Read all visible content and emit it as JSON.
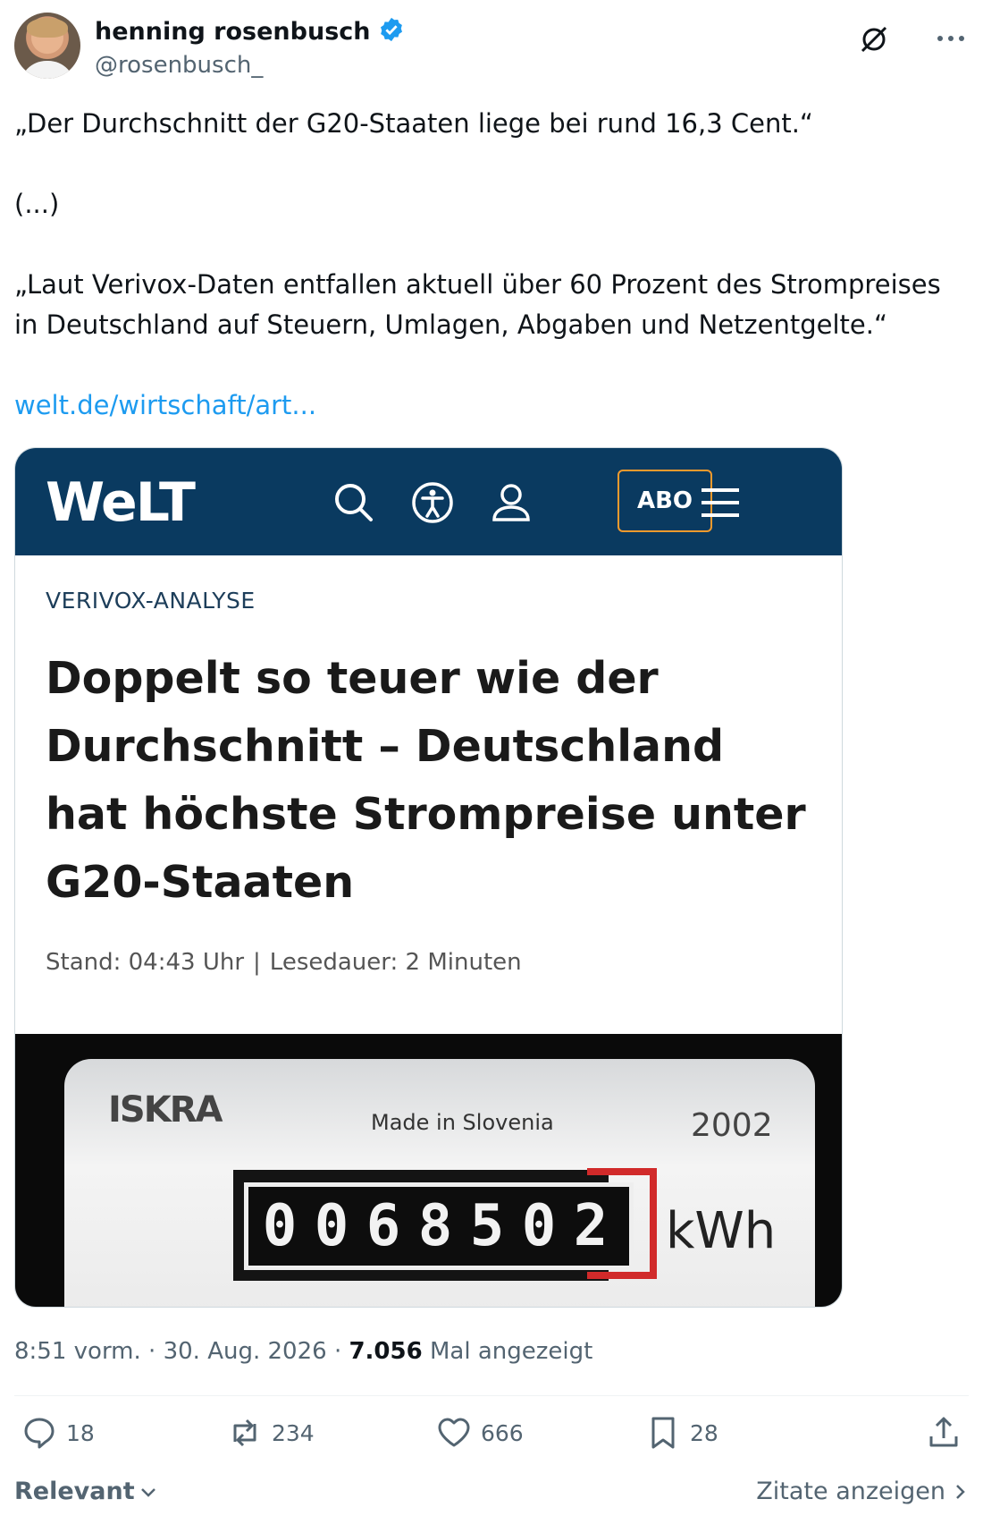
{
  "author": {
    "display_name": "henning rosenbusch",
    "handle": "@rosenbusch_",
    "verified": true
  },
  "tweet": {
    "paragraph1": "„Der Durchschnitt der G20-Staaten liege bei rund 16,3 Cent.“",
    "paragraph2": "(...)",
    "paragraph3": "„Laut Verivox-Daten entfallen aktuell über 60 Prozent des Strompreises in Deutschland auf Steuern, Umlagen, Abgaben und Netzentgelte.“",
    "link": "welt.de/wirtschaft/art..."
  },
  "card": {
    "brand": "WeLT",
    "abo_label": "ABO",
    "kicker": "VERIVOX-ANALYSE",
    "headline": "Doppelt so teuer wie der Durchschnitt – Deutschland hat höchste Strompreise unter G20-Staaten",
    "stand": "Stand: 04:43 Uhr",
    "separator": "|",
    "lesedauer": "Lesedauer: 2 Minuten",
    "photo": {
      "brand": "ISKRA",
      "made_in": "Made in Slovenia",
      "year": "2002",
      "digits": [
        "0",
        "0",
        "6",
        "8",
        "5",
        "0",
        "2"
      ],
      "unit": "kWh"
    }
  },
  "meta": {
    "time": "8:51 vorm.",
    "dot1": "·",
    "date": "30. Aug. 2026",
    "dot2": "·",
    "views_count": "7.056",
    "views_label": "Mal angezeigt"
  },
  "actions": {
    "replies": "18",
    "reposts": "234",
    "likes": "666",
    "bookmarks": "28"
  },
  "footer": {
    "sort_label": "Relevant",
    "quotes_label": "Zitate anzeigen"
  },
  "colors": {
    "link": "#1d9bf0",
    "verified": "#1d9bf0",
    "welt_bar": "#0a3a60",
    "abo_border": "#f39a2d"
  }
}
